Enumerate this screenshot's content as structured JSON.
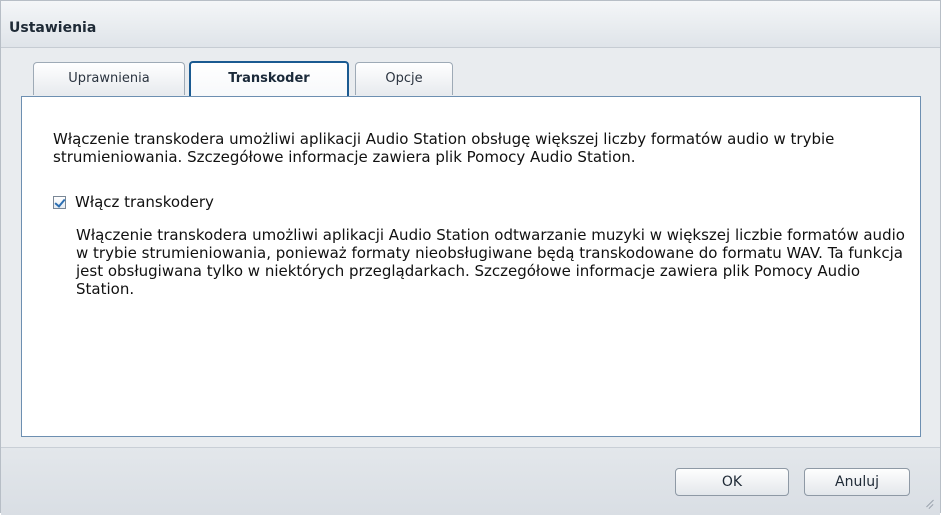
{
  "window": {
    "title": "Ustawienia"
  },
  "tabs": [
    {
      "label": "Uprawnienia",
      "active": false
    },
    {
      "label": "Transkoder",
      "active": true
    },
    {
      "label": "Opcje",
      "active": false
    }
  ],
  "panel": {
    "intro_text": "Włączenie transkodera umożliwi aplikacji Audio Station obsługę większej liczby formatów audio w trybie strumieniowania. Szczegółowe informacje zawiera plik Pomocy Audio Station.",
    "checkbox": {
      "label": "Włącz transkodery",
      "checked": true
    },
    "description_text": "Włączenie transkodera umożliwi aplikacji Audio Station odtwarzanie muzyki w większej liczbie formatów audio w trybie strumieniowania, ponieważ formaty nieobsługiwane będą transkodowane do formatu WAV. Ta funkcja jest obsługiwana tylko w niektórych przeglądarkach. Szczegółowe informacje zawiera plik Pomocy Audio Station."
  },
  "footer": {
    "ok_label": "OK",
    "cancel_label": "Anuluj"
  },
  "colors": {
    "active_tab_border": "#1a5a91",
    "panel_border": "#6d8fb1",
    "checkbox_tick": "#2c6fb3"
  }
}
